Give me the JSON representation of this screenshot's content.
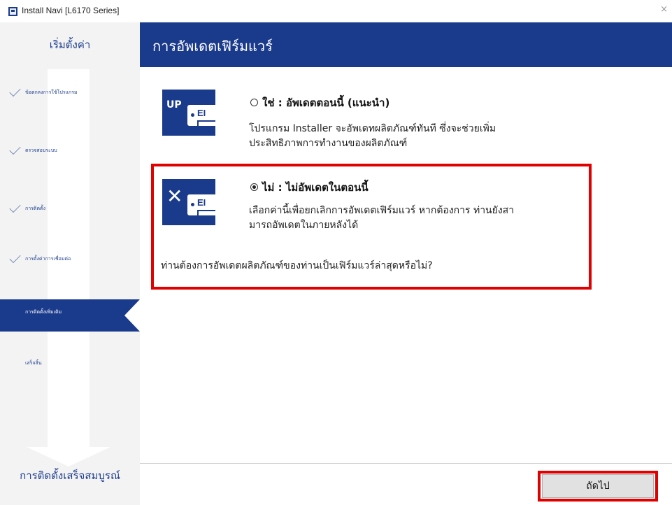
{
  "window": {
    "title": "Install Navi [L6170 Series]",
    "close": "×"
  },
  "sidebar": {
    "header": "เริ่มตั้งค่า",
    "steps": [
      {
        "label": "ข้อตกลงการใช้โปรแกรม",
        "state": "done"
      },
      {
        "label": "ตรวจสอบระบบ",
        "state": "done"
      },
      {
        "label": "การติดตั้ง",
        "state": "done"
      },
      {
        "label": "การตั้งค่าการเชื่อมต่อ",
        "state": "done"
      },
      {
        "label": "การติดตั้งเพิ่มเติม",
        "state": "active"
      },
      {
        "label": "เสร็จสิ้น",
        "state": "pending"
      }
    ],
    "footer": "การติดตั้งเสร็จสมบูรณ์"
  },
  "header": {
    "title": "การอัพเดตเฟิร์มแวร์"
  },
  "options": [
    {
      "icon": "update-up-icon",
      "icon_symbol": "UP",
      "icon_device_text": "EI",
      "selected": false,
      "title": "ใช่ : อัพเดตตอนนี้ (แนะนำ)",
      "desc_line1": "โปรแกรม Installer จะอัพเดทผลิตภัณฑ์ทันที ซึ่งจะช่วยเพิ่ม",
      "desc_line2": "ประสิทธิภาพการทำงานของผลิตภัณฑ์"
    },
    {
      "icon": "no-update-x-icon",
      "icon_symbol": "✕",
      "icon_device_text": "EI",
      "selected": true,
      "title": "ไม่ : ไม่อัพเดตในตอนนี้",
      "desc_line1": "เลือกค่านี้เพื่อยกเลิกการอัพเดตเฟิร์มแวร์  หากต้องการ ท่านยังสา",
      "desc_line2": "มารถอัพเดตในภายหลังได้"
    }
  ],
  "question": "ท่านต้องการอัพเดตผลิตภัณฑ์ของท่านเป็นเฟิร์มแวร์ล่าสุดหรือไม่?",
  "footer": {
    "next_label": "ถัดไป"
  },
  "colors": {
    "brand": "#1a3a8c",
    "highlight": "#e00000",
    "sidebar_bg": "#f3f3f3"
  }
}
